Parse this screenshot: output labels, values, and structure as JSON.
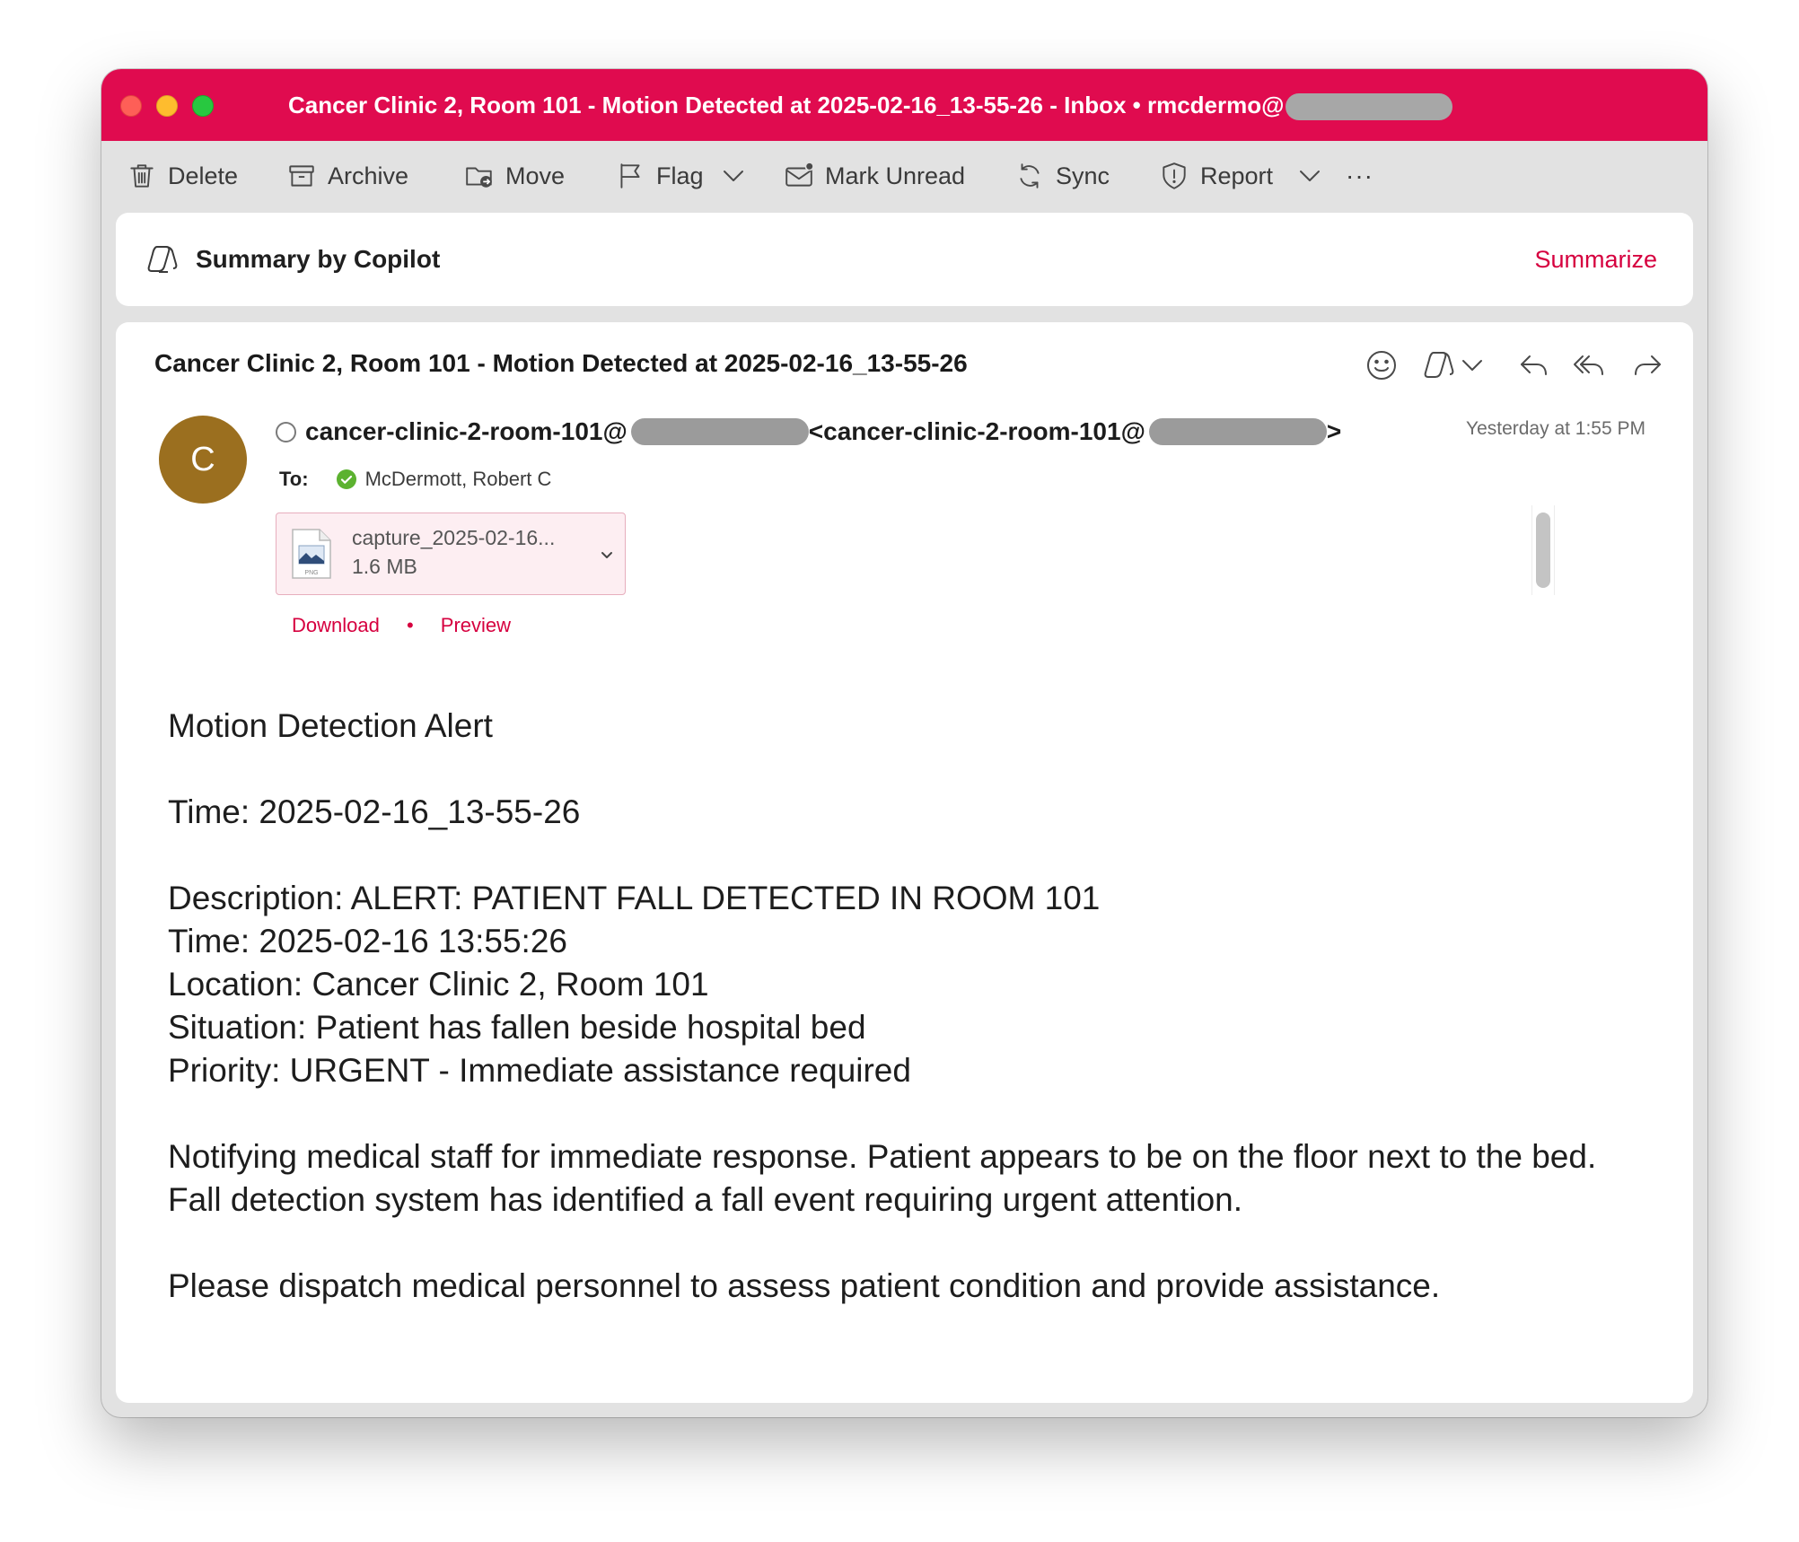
{
  "window": {
    "title_prefix": "Cancer Clinic 2, Room 101 - Motion Detected at 2025-02-16_13-55-26 - Inbox • rmcdermo@",
    "accent_color": "#e00b4f"
  },
  "toolbar": {
    "delete_label": "Delete",
    "archive_label": "Archive",
    "move_label": "Move",
    "flag_label": "Flag",
    "mark_unread_label": "Mark Unread",
    "sync_label": "Sync",
    "report_label": "Report",
    "more_label": "···"
  },
  "copilot": {
    "label": "Summary by Copilot",
    "summarize_label": "Summarize"
  },
  "message": {
    "subject": "Cancer Clinic 2, Room 101 - Motion Detected at 2025-02-16_13-55-26",
    "avatar_initial": "C",
    "avatar_color": "#9b6f1f",
    "from_address_prefix": "cancer-clinic-2-room-101@",
    "from_display_prefix": "<cancer-clinic-2-room-101@",
    "from_display_suffix": ">",
    "timestamp": "Yesterday at 1:55 PM",
    "to_label": "To:",
    "to_name": "McDermott, Robert C",
    "attachment": {
      "name": "capture_2025-02-16...",
      "size": "1.6 MB",
      "download_label": "Download",
      "separator": "•",
      "preview_label": "Preview"
    },
    "body": {
      "heading": "Motion Detection Alert",
      "time_line": "Time: 2025-02-16_13-55-26",
      "description_line": "Description: ALERT: PATIENT FALL DETECTED IN ROOM 101",
      "time2_line": "Time: 2025-02-16 13:55:26",
      "location_line": "Location: Cancer Clinic 2, Room 101",
      "situation_line": "Situation: Patient has fallen beside hospital bed",
      "priority_line": "Priority: URGENT - Immediate assistance required",
      "notify_paragraph": "Notifying medical staff for immediate response. Patient appears to be on the floor next to the bed. Fall detection system has identified a fall event requiring urgent attention.",
      "dispatch_paragraph": "Please dispatch medical personnel to assess patient condition and provide assistance."
    }
  },
  "icons": {
    "delete": "trash-icon",
    "archive": "archive-box-icon",
    "move": "folder-move-icon",
    "flag": "flag-icon",
    "mark_unread": "envelope-dot-icon",
    "sync": "sync-arrows-icon",
    "report": "shield-alert-icon",
    "copilot": "copilot-icon",
    "emoji": "smiley-icon",
    "reply": "reply-icon",
    "reply_all": "reply-all-icon",
    "forward": "forward-icon"
  }
}
